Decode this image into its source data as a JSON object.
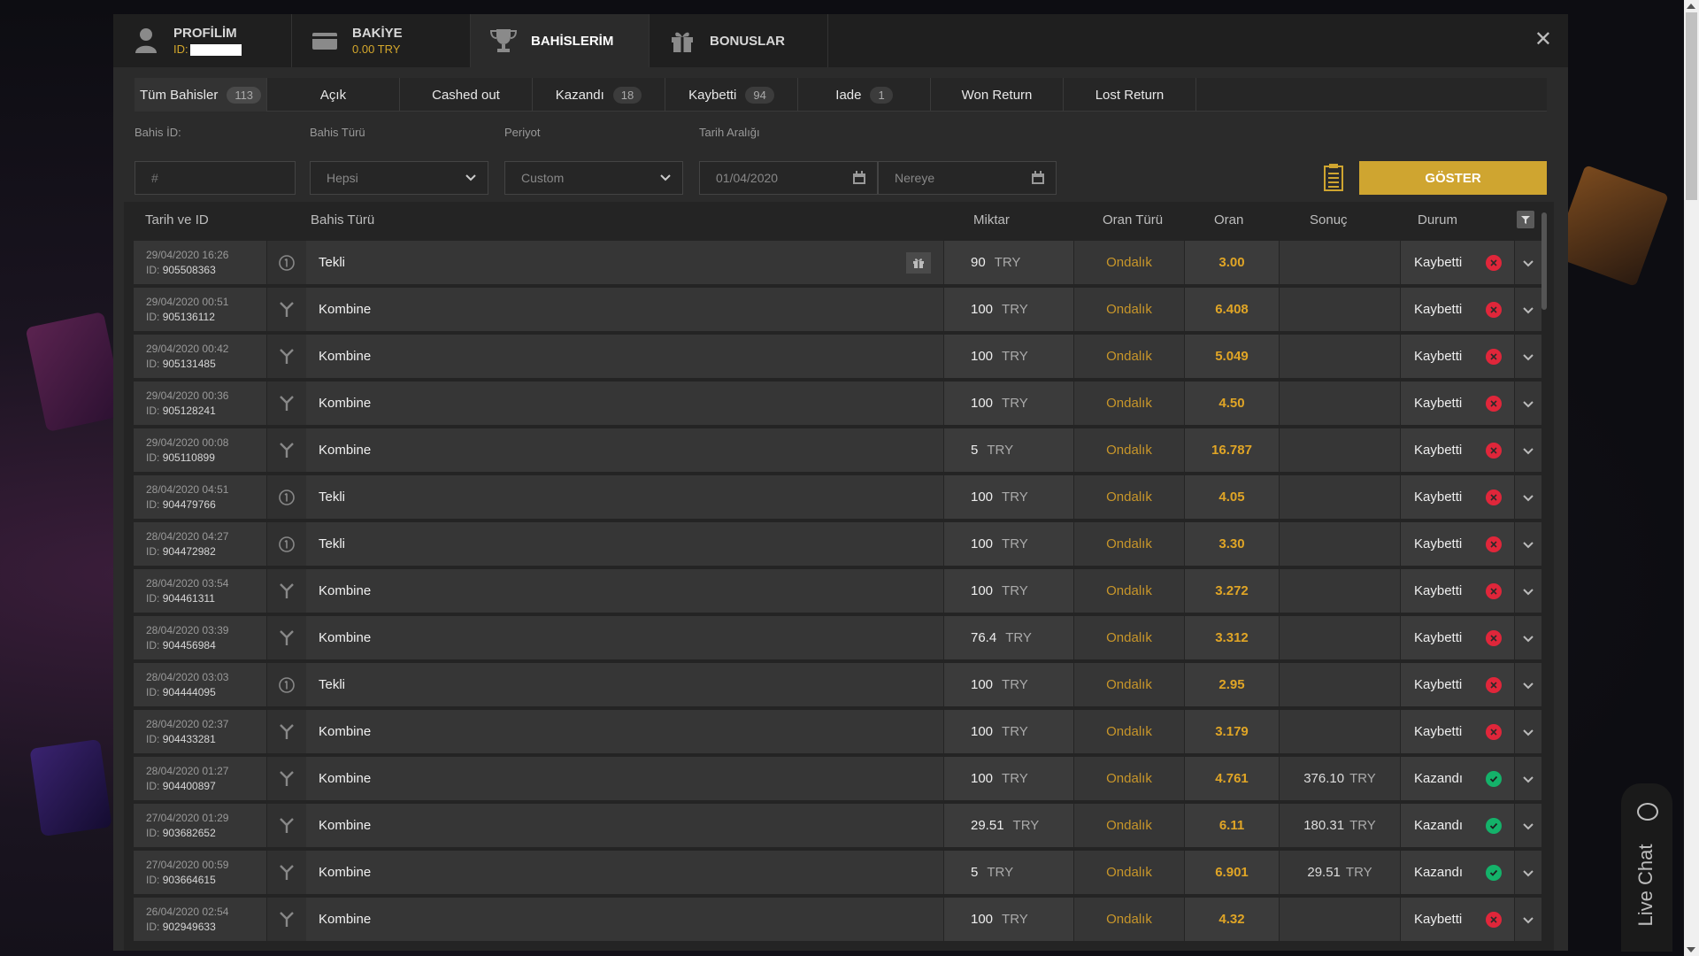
{
  "nav": {
    "profile": {
      "title": "PROFİLİM",
      "sub": "ID:"
    },
    "balance": {
      "title": "BAKİYE",
      "sub": "0.00 TRY"
    },
    "bets": {
      "title": "BAHİSLERİM"
    },
    "bonus": {
      "title": "BONUSLAR"
    },
    "close": "✕"
  },
  "tabs": [
    {
      "label": "Tüm Bahisler",
      "count": "113"
    },
    {
      "label": "Açık",
      "count": ""
    },
    {
      "label": "Cashed out",
      "count": ""
    },
    {
      "label": "Kazandı",
      "count": "18"
    },
    {
      "label": "Kaybetti",
      "count": "94"
    },
    {
      "label": "Iade",
      "count": "1"
    },
    {
      "label": "Won Return",
      "count": ""
    },
    {
      "label": "Lost Return",
      "count": ""
    }
  ],
  "filters": {
    "bet_id_label": "Bahis İD:",
    "bet_id_placeholder": "#",
    "bet_type_label": "Bahis Türü",
    "bet_type_value": "Hepsi",
    "period_label": "Periyot",
    "period_value": "Custom",
    "date_label": "Tarih Aralığı",
    "date_from": "01/04/2020",
    "date_to_placeholder": "Nereye",
    "show_button": "GÖSTER"
  },
  "table": {
    "headers": {
      "date": "Tarih ve ID",
      "type": "Bahis Türü",
      "amount": "Miktar",
      "odd_type": "Oran Türü",
      "odd": "Oran",
      "result": "Sonuç",
      "status": "Durum"
    },
    "id_prefix": "ID:",
    "currency": "TRY",
    "rows": [
      {
        "date": "29/04/2020 16:26",
        "id": "905508363",
        "kind": "single",
        "type": "Tekli",
        "gift": true,
        "amount": "90",
        "odd_type": "Ondalık",
        "odd": "3.00",
        "result": "",
        "status": "Kaybetti",
        "won": false
      },
      {
        "date": "29/04/2020 00:51",
        "id": "905136112",
        "kind": "combo",
        "type": "Kombine",
        "gift": false,
        "amount": "100",
        "odd_type": "Ondalık",
        "odd": "6.408",
        "result": "",
        "status": "Kaybetti",
        "won": false
      },
      {
        "date": "29/04/2020 00:42",
        "id": "905131485",
        "kind": "combo",
        "type": "Kombine",
        "gift": false,
        "amount": "100",
        "odd_type": "Ondalık",
        "odd": "5.049",
        "result": "",
        "status": "Kaybetti",
        "won": false
      },
      {
        "date": "29/04/2020 00:36",
        "id": "905128241",
        "kind": "combo",
        "type": "Kombine",
        "gift": false,
        "amount": "100",
        "odd_type": "Ondalık",
        "odd": "4.50",
        "result": "",
        "status": "Kaybetti",
        "won": false
      },
      {
        "date": "29/04/2020 00:08",
        "id": "905110899",
        "kind": "combo",
        "type": "Kombine",
        "gift": false,
        "amount": "5",
        "odd_type": "Ondalık",
        "odd": "16.787",
        "result": "",
        "status": "Kaybetti",
        "won": false
      },
      {
        "date": "28/04/2020 04:51",
        "id": "904479766",
        "kind": "single",
        "type": "Tekli",
        "gift": false,
        "amount": "100",
        "odd_type": "Ondalık",
        "odd": "4.05",
        "result": "",
        "status": "Kaybetti",
        "won": false
      },
      {
        "date": "28/04/2020 04:27",
        "id": "904472982",
        "kind": "single",
        "type": "Tekli",
        "gift": false,
        "amount": "100",
        "odd_type": "Ondalık",
        "odd": "3.30",
        "result": "",
        "status": "Kaybetti",
        "won": false
      },
      {
        "date": "28/04/2020 03:54",
        "id": "904461311",
        "kind": "combo",
        "type": "Kombine",
        "gift": false,
        "amount": "100",
        "odd_type": "Ondalık",
        "odd": "3.272",
        "result": "",
        "status": "Kaybetti",
        "won": false
      },
      {
        "date": "28/04/2020 03:39",
        "id": "904456984",
        "kind": "combo",
        "type": "Kombine",
        "gift": false,
        "amount": "76.4",
        "odd_type": "Ondalık",
        "odd": "3.312",
        "result": "",
        "status": "Kaybetti",
        "won": false
      },
      {
        "date": "28/04/2020 03:03",
        "id": "904444095",
        "kind": "single",
        "type": "Tekli",
        "gift": false,
        "amount": "100",
        "odd_type": "Ondalık",
        "odd": "2.95",
        "result": "",
        "status": "Kaybetti",
        "won": false
      },
      {
        "date": "28/04/2020 02:37",
        "id": "904433281",
        "kind": "combo",
        "type": "Kombine",
        "gift": false,
        "amount": "100",
        "odd_type": "Ondalık",
        "odd": "3.179",
        "result": "",
        "status": "Kaybetti",
        "won": false
      },
      {
        "date": "28/04/2020 01:27",
        "id": "904400897",
        "kind": "combo",
        "type": "Kombine",
        "gift": false,
        "amount": "100",
        "odd_type": "Ondalık",
        "odd": "4.761",
        "result": "376.10",
        "status": "Kazandı",
        "won": true
      },
      {
        "date": "27/04/2020 01:29",
        "id": "903682652",
        "kind": "combo",
        "type": "Kombine",
        "gift": false,
        "amount": "29.51",
        "odd_type": "Ondalık",
        "odd": "6.11",
        "result": "180.31",
        "status": "Kazandı",
        "won": true
      },
      {
        "date": "27/04/2020 00:59",
        "id": "903664615",
        "kind": "combo",
        "type": "Kombine",
        "gift": false,
        "amount": "5",
        "odd_type": "Ondalık",
        "odd": "6.901",
        "result": "29.51",
        "status": "Kazandı",
        "won": true
      },
      {
        "date": "26/04/2020 02:54",
        "id": "902949633",
        "kind": "combo",
        "type": "Kombine",
        "gift": false,
        "amount": "100",
        "odd_type": "Ondalık",
        "odd": "4.32",
        "result": "",
        "status": "Kaybetti",
        "won": false
      }
    ]
  },
  "live_chat": "Live Chat",
  "colors": {
    "accent": "#cfa530",
    "odds": "#e0a526",
    "lost": "#e0263a",
    "won": "#14b26a"
  }
}
